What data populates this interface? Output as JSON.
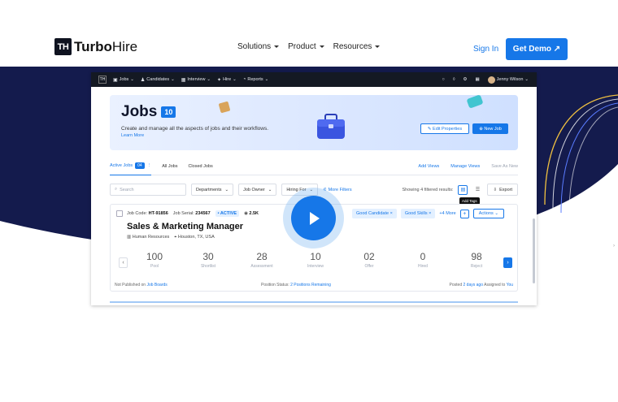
{
  "brand": {
    "mark": "TH",
    "name_bold": "Turbo",
    "name_light": "Hire"
  },
  "nav": {
    "items": [
      {
        "label": "Solutions"
      },
      {
        "label": "Product"
      },
      {
        "label": "Resources"
      }
    ],
    "signin": "Sign In",
    "cta": "Get Demo ↗"
  },
  "app": {
    "topbar": {
      "mark": "TH",
      "items": [
        {
          "label": "Jobs"
        },
        {
          "label": "Candidates"
        },
        {
          "label": "Interview"
        },
        {
          "label": "Hire"
        },
        {
          "label": "Reports"
        }
      ],
      "user": "Jenny Wilson"
    },
    "banner": {
      "title": "Jobs",
      "count": "10",
      "description": "Create and manage all the aspects of jobs and their workflows.",
      "learn_more": "Learn More",
      "edit_properties": "Edit Properties",
      "new_job": "New Job"
    },
    "tabs": {
      "active": "Active Jobs",
      "active_count": "04",
      "all": "All Jobs",
      "closed": "Closed Jobs",
      "add_views": "Add Views",
      "manage_views": "Manage Views",
      "save_as_new": "Save As New"
    },
    "filters": {
      "search_placeholder": "Search",
      "departments": "Departments",
      "job_owner": "Job Owner",
      "hiring_for": "Hiring For",
      "more_filters": "More Filters",
      "showing": "Showing 4 filtered results:",
      "export": "Export",
      "tooltip": "Add Tags"
    },
    "job": {
      "code_label": "Job Code:",
      "code": "HT-91856",
      "serial_label": "Job Serial:",
      "serial": "234567",
      "status": "ACTIVE",
      "salary": "2.5K",
      "title": "Sales & Marketing Manager",
      "department": "Human Resources",
      "location": "Houston, TX, USA",
      "tags": [
        {
          "label": "Good Candidate"
        },
        {
          "label": "Good Skills"
        }
      ],
      "more_tags": "+4 More",
      "actions": "Actions",
      "stats": [
        {
          "value": "100",
          "label": "Pool"
        },
        {
          "value": "30",
          "label": "Shortlist"
        },
        {
          "value": "28",
          "label": "Assessment"
        },
        {
          "value": "10",
          "label": "Interview"
        },
        {
          "value": "02",
          "label": "Offer"
        },
        {
          "value": "0",
          "label": "Hired"
        },
        {
          "value": "98",
          "label": "Reject"
        }
      ],
      "footer": {
        "not_published": "Not Published on",
        "job_boards": "Job Boards",
        "position_status": "Position Status:",
        "positions_remaining": "2 Positions Remaining",
        "posted": "Posted",
        "posted_ago": "2 days ago",
        "assigned": "Assigned to",
        "assigned_to": "You"
      }
    }
  },
  "colors": {
    "accent": "#1677e8",
    "hero": "#141b4d"
  }
}
